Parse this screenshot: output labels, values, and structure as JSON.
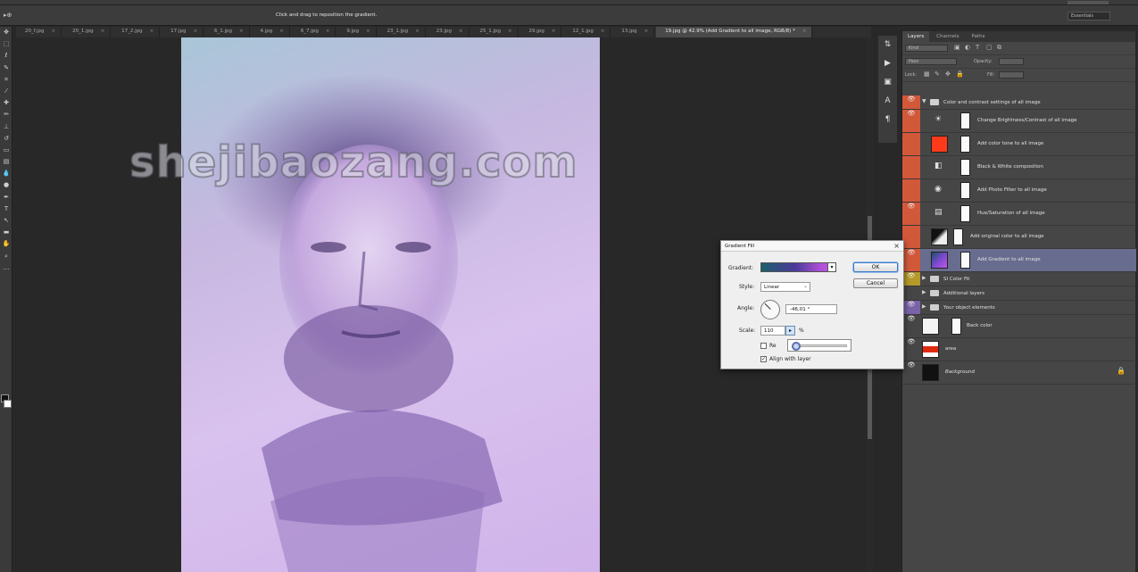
{
  "menubar": {
    "hint": "Click and drag to reposition the gradient.",
    "search": ""
  },
  "options": {
    "tool_icon": "▸⊕",
    "message": "Click and drag to reposition the gradient.",
    "workspace": "Essentials"
  },
  "tabs": [
    {
      "label": "20_f.jpg"
    },
    {
      "label": "20_1.jpg"
    },
    {
      "label": "17_2.jpg"
    },
    {
      "label": "17.jpg"
    },
    {
      "label": "6_1.jpg"
    },
    {
      "label": "4.jpg"
    },
    {
      "label": "6_7.jpg"
    },
    {
      "label": "9.jpg"
    },
    {
      "label": "23_1.jpg"
    },
    {
      "label": "23.jpg"
    },
    {
      "label": "25_1.jpg"
    },
    {
      "label": "29.jpg"
    },
    {
      "label": "12_1.jpg"
    },
    {
      "label": "13.jpg"
    },
    {
      "label": "19.jpg @ 42.9% (Add Gradient to all image, RGB/8) *"
    }
  ],
  "watermark": "shejibaozang.com",
  "panel_tabs": [
    "Layers",
    "Channels",
    "Paths"
  ],
  "layer_controls": {
    "kind": "Kind",
    "mode": "Pass",
    "opacity_label": "Opacity:",
    "fill_label": "Fill:",
    "lock_label": "Lock:"
  },
  "layers": [
    {
      "name": "Color and contrast settings of all image",
      "type": "group-open",
      "tag": "red"
    },
    {
      "name": "Change Brightness/Contrast of all image",
      "type": "adjust",
      "tag": "red",
      "icon": "☀"
    },
    {
      "name": "Add color tone to all image",
      "type": "fill",
      "tag": "red",
      "thumb_color": "#ff3a1a"
    },
    {
      "name": "Black & White composition",
      "type": "adjust",
      "tag": "red",
      "icon": "◧"
    },
    {
      "name": "Add Photo Filter to all image",
      "type": "adjust",
      "tag": "red",
      "icon": "◉"
    },
    {
      "name": "Hue/Saturation of all image",
      "type": "adjust",
      "tag": "red",
      "icon": "▤"
    },
    {
      "name": "Add original color to all image",
      "type": "image",
      "tag": "red"
    },
    {
      "name": "Add Gradient to all image",
      "type": "gradient",
      "tag": "red",
      "selected": true
    },
    {
      "name": "SI Color Fit",
      "type": "group",
      "tag": "yellow"
    },
    {
      "name": "Additional layers",
      "type": "group",
      "tag": "none"
    },
    {
      "name": "Your object elements",
      "type": "group",
      "tag": "violet"
    },
    {
      "name": "Back color",
      "type": "image",
      "tag": "none"
    },
    {
      "name": "area",
      "type": "image",
      "tag": "none"
    },
    {
      "name": "Background",
      "type": "background",
      "tag": "none"
    }
  ],
  "dialog": {
    "title": "Gradient Fill",
    "gradient_label": "Gradient:",
    "style_label": "Style:",
    "style_value": "Linear",
    "angle_label": "Angle:",
    "angle_value": "-46,01",
    "angle_unit": "°",
    "scale_label": "Scale:",
    "scale_value": "110",
    "scale_unit": "%",
    "reverse_label": "Re",
    "align_label": "Align with layer",
    "ok": "OK",
    "cancel": "Cancel",
    "reverse_checked": false,
    "align_checked": true
  }
}
